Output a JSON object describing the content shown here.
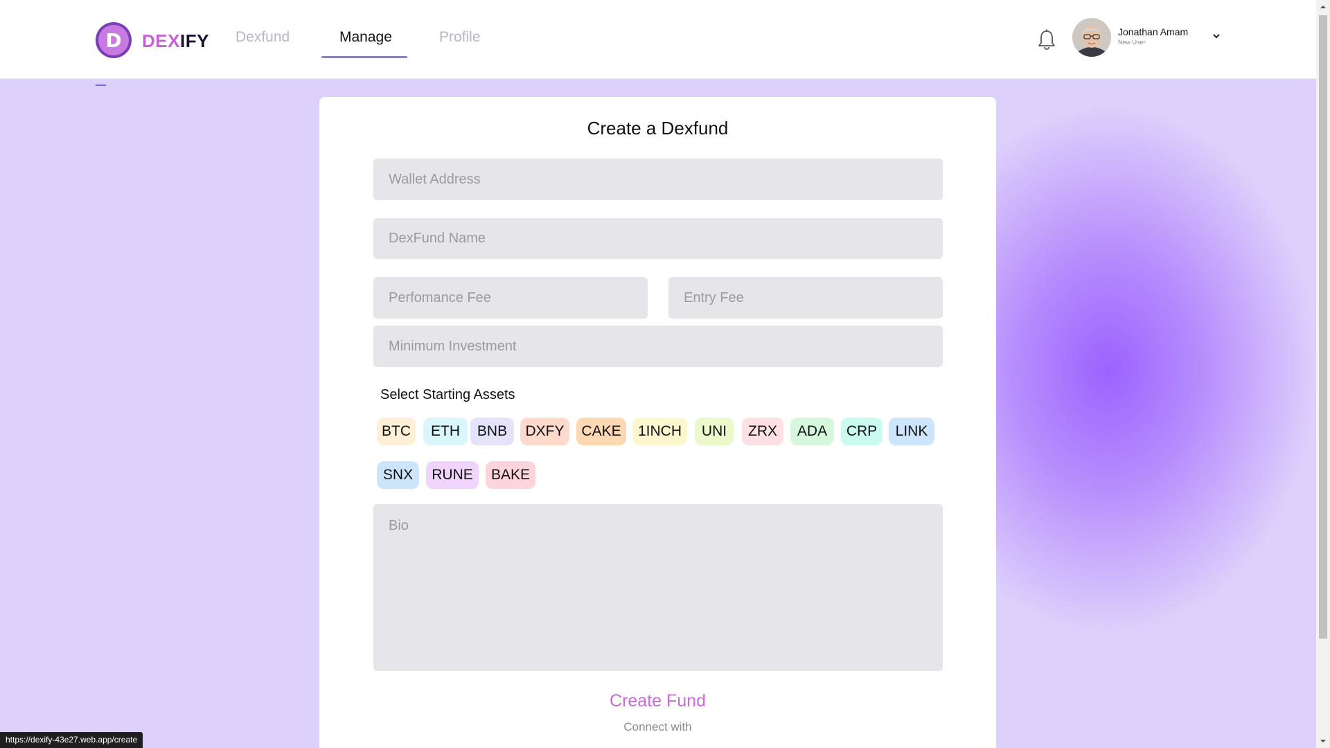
{
  "brand": {
    "prefix": "DEX",
    "suffix": "IFY",
    "letter": "D"
  },
  "nav": {
    "items": [
      "Dexfund",
      "Manage",
      "Profile"
    ],
    "active": "Manage"
  },
  "user": {
    "name": "Jonathan Amam",
    "role": "New User"
  },
  "form": {
    "title": "Create a Dexfund",
    "wallet_placeholder": "Wallet Address",
    "name_placeholder": "DexFund Name",
    "performance_placeholder": "Perfomance Fee",
    "entry_placeholder": "Entry Fee",
    "min_placeholder": "Minimum Investment",
    "assets_label": "Select Starting Assets",
    "assets": [
      "BTC",
      "ETH",
      "BNB",
      "DXFY",
      "CAKE",
      "1INCH",
      "UNI",
      "ZRX",
      "ADA",
      "CRP",
      "LINK",
      "SNX",
      "RUNE",
      "BAKE"
    ],
    "bio_placeholder": "Bio",
    "submit_label": "Create Fund",
    "connect_label": "Connect with"
  },
  "status_url": "https://dexify-43e27.web.app/create",
  "colors": {
    "accent": "#c861d8",
    "background": "#ddd0fb",
    "chips": [
      "#fdf0d6",
      "#d9f6fb",
      "#e4e3fb",
      "#fed9cc",
      "#fdd9b3",
      "#fdf7cf",
      "#ecfacb",
      "#fde0e3",
      "#d6f7dc",
      "#cbfaf0",
      "#cde6fd",
      "#cce5fb",
      "#f0d4fb",
      "#fdd3dc"
    ]
  }
}
